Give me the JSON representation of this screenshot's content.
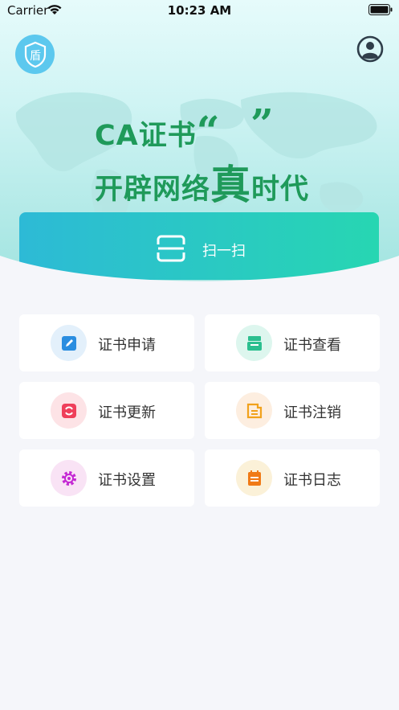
{
  "status_bar": {
    "carrier": "Carrier",
    "time": "10:23 AM"
  },
  "header": {
    "logo_char": "盾"
  },
  "banner": {
    "line1": "CA证书",
    "open_quote": "“",
    "highlight": "真",
    "close_quote": "”",
    "line2_prefix": "开辟网络",
    "line2_suffix": "时代"
  },
  "scan": {
    "label": "扫一扫"
  },
  "menu": [
    {
      "label": "证书申请",
      "icon": "edit-icon",
      "bg": "#e3f0fb",
      "fg": "#2a8de0"
    },
    {
      "label": "证书查看",
      "icon": "view-icon",
      "bg": "#ddf6ee",
      "fg": "#2bbf8f"
    },
    {
      "label": "证书更新",
      "icon": "refresh-icon",
      "bg": "#fde3e6",
      "fg": "#ef3f5a"
    },
    {
      "label": "证书注销",
      "icon": "revoke-icon",
      "bg": "#fdeee0",
      "fg": "#f1a21c"
    },
    {
      "label": "证书设置",
      "icon": "gear-icon",
      "bg": "#f9e3f5",
      "fg": "#c428d3"
    },
    {
      "label": "证书日志",
      "icon": "log-icon",
      "bg": "#fbf1d8",
      "fg": "#f07a16"
    }
  ]
}
